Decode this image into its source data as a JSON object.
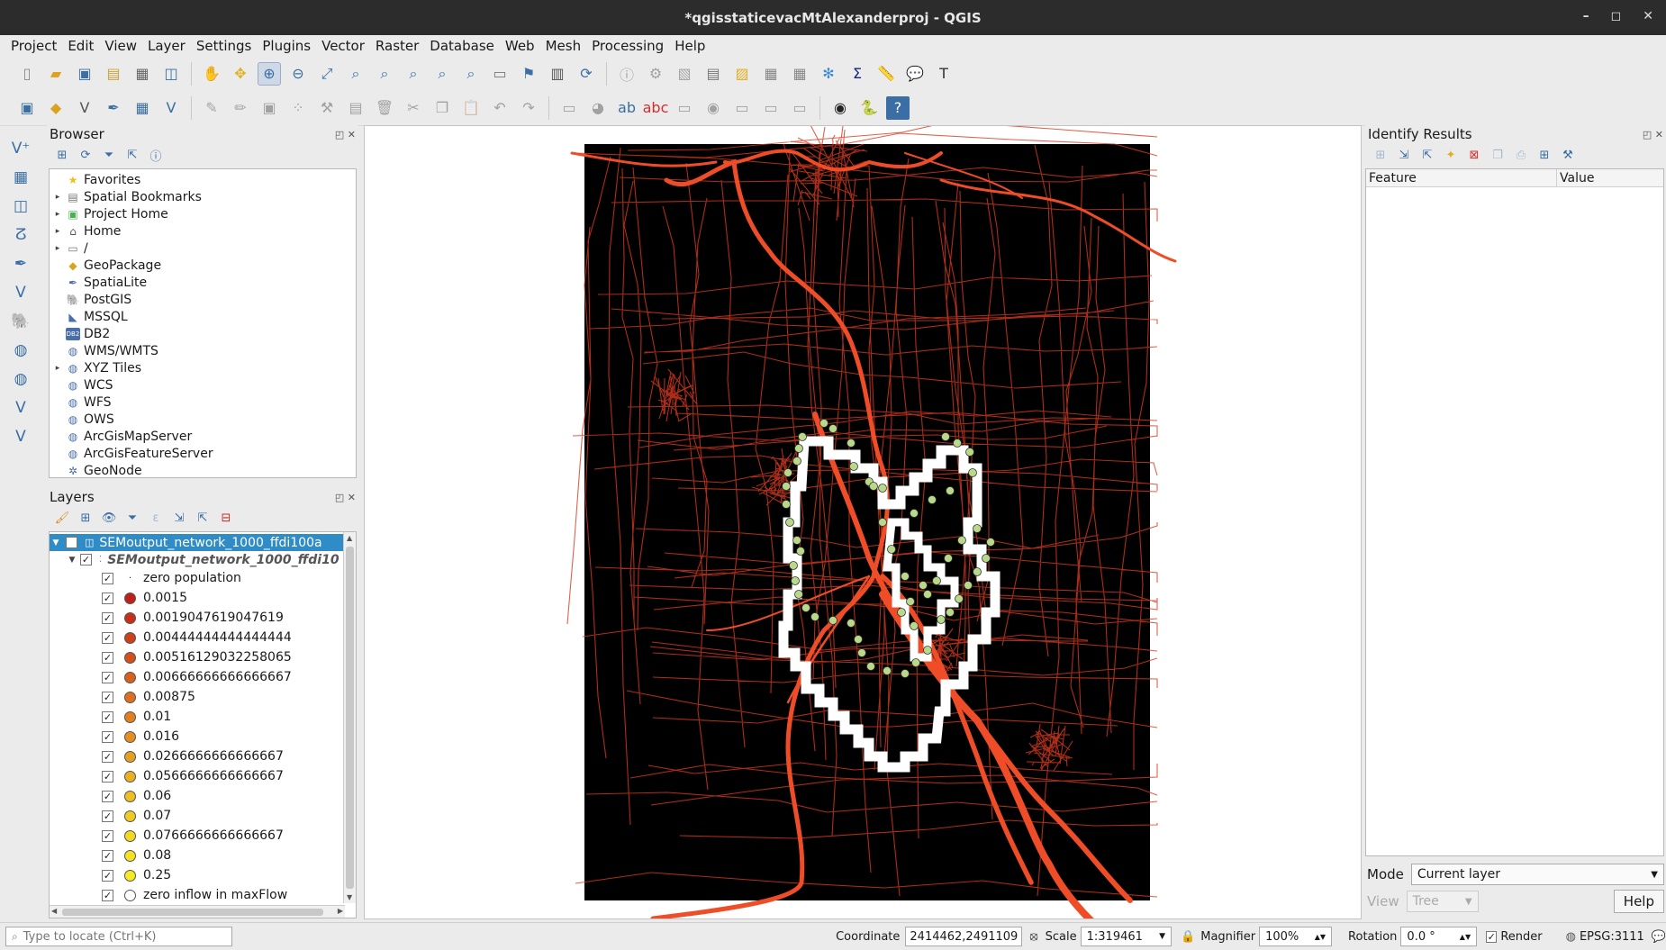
{
  "window": {
    "title": "*qgisstaticevacMtAlexanderproj - QGIS",
    "minimize": "–",
    "restore": "◻",
    "close": "✕"
  },
  "menu": [
    "Project",
    "Edit",
    "View",
    "Layer",
    "Settings",
    "Plugins",
    "Vector",
    "Raster",
    "Database",
    "Web",
    "Mesh",
    "Processing",
    "Help"
  ],
  "browser": {
    "title": "Browser",
    "items": [
      {
        "label": "Favorites",
        "icon": "star-icon",
        "glyph": "★",
        "color": "#e8c21b",
        "arrow": ""
      },
      {
        "label": "Spatial Bookmarks",
        "icon": "bookmark-icon",
        "glyph": "▤",
        "color": "#777",
        "arrow": "▸"
      },
      {
        "label": "Project Home",
        "icon": "project-home-icon",
        "glyph": "▣",
        "color": "#4caf50",
        "arrow": "▸"
      },
      {
        "label": "Home",
        "icon": "home-icon",
        "glyph": "⌂",
        "color": "#555",
        "arrow": "▸"
      },
      {
        "label": "/",
        "icon": "folder-icon",
        "glyph": "▭",
        "color": "#777",
        "arrow": "▸"
      },
      {
        "label": "GeoPackage",
        "icon": "geopackage-icon",
        "glyph": "◆",
        "color": "#d8a420",
        "arrow": ""
      },
      {
        "label": "SpatiaLite",
        "icon": "spatialite-icon",
        "glyph": "✒",
        "color": "#4a6ea8",
        "arrow": ""
      },
      {
        "label": "PostGIS",
        "icon": "postgis-icon",
        "glyph": "🐘",
        "color": "#336791",
        "arrow": ""
      },
      {
        "label": "MSSQL",
        "icon": "mssql-icon",
        "glyph": "◣",
        "color": "#4a6ea8",
        "arrow": ""
      },
      {
        "label": "DB2",
        "icon": "db2-icon",
        "glyph": "DB2",
        "color": "#4a6ea8",
        "arrow": ""
      },
      {
        "label": "WMS/WMTS",
        "icon": "wms-icon",
        "glyph": "◍",
        "color": "#4a6ea8",
        "arrow": ""
      },
      {
        "label": "XYZ Tiles",
        "icon": "xyz-tiles-icon",
        "glyph": "◍",
        "color": "#4a6ea8",
        "arrow": "▸"
      },
      {
        "label": "WCS",
        "icon": "wcs-icon",
        "glyph": "◍",
        "color": "#4a6ea8",
        "arrow": ""
      },
      {
        "label": "WFS",
        "icon": "wfs-icon",
        "glyph": "◍",
        "color": "#4a6ea8",
        "arrow": ""
      },
      {
        "label": "OWS",
        "icon": "ows-icon",
        "glyph": "◍",
        "color": "#4a6ea8",
        "arrow": ""
      },
      {
        "label": "ArcGisMapServer",
        "icon": "arcgis-map-icon",
        "glyph": "◍",
        "color": "#4a6ea8",
        "arrow": ""
      },
      {
        "label": "ArcGisFeatureServer",
        "icon": "arcgis-feature-icon",
        "glyph": "◍",
        "color": "#4a6ea8",
        "arrow": ""
      },
      {
        "label": "GeoNode",
        "icon": "geonode-icon",
        "glyph": "✲",
        "color": "#4a6ea8",
        "arrow": ""
      }
    ]
  },
  "layers": {
    "title": "Layers",
    "layer_name": "SEMoutput_network_1000_ffdi100a",
    "sublayer_name": "SEMoutput_network_1000_ffdi10",
    "classes": [
      {
        "label": "zero population",
        "color": "none",
        "style": "dot"
      },
      {
        "label": "0.0015",
        "color": "#c0201a"
      },
      {
        "label": "0.0019047619047619",
        "color": "#c6301a"
      },
      {
        "label": "0.00444444444444444",
        "color": "#cc401b"
      },
      {
        "label": "0.00516129032258065",
        "color": "#d2501c"
      },
      {
        "label": "0.00666666666666667",
        "color": "#d8601d"
      },
      {
        "label": "0.00875",
        "color": "#dd701e"
      },
      {
        "label": "0.01",
        "color": "#e0801f"
      },
      {
        "label": "0.016",
        "color": "#e39020"
      },
      {
        "label": "0.0266666666666667",
        "color": "#e6a021"
      },
      {
        "label": "0.0566666666666667",
        "color": "#e9b022"
      },
      {
        "label": "0.06",
        "color": "#ecbf22"
      },
      {
        "label": "0.07",
        "color": "#efcc22"
      },
      {
        "label": "0.0766666666666667",
        "color": "#f2d822"
      },
      {
        "label": "0.08",
        "color": "#f4e122"
      },
      {
        "label": "0.25",
        "color": "#f6ea22"
      },
      {
        "label": "zero inflow in maxFlow",
        "color": "#ffffff"
      }
    ]
  },
  "identify": {
    "title": "Identify Results",
    "col_feature": "Feature",
    "col_value": "Value",
    "mode_label": "Mode",
    "mode_value": "Current layer",
    "view_label": "View",
    "view_value": "Tree",
    "help": "Help"
  },
  "status": {
    "locator_placeholder": "Type to locate (Ctrl+K)",
    "coordinate_label": "Coordinate",
    "coordinate_value": "2414462,2491109",
    "scale_label": "Scale",
    "scale_value": "1:319461",
    "magnifier_label": "Magnifier",
    "magnifier_value": "100%",
    "rotation_label": "Rotation",
    "rotation_value": "0.0 °",
    "render_label": "Render",
    "crs": "EPSG:3111"
  },
  "colors": {
    "road": "#e8431f",
    "road_major": "#ee4d28",
    "canvas_black": "#000000",
    "boundary": "#ffffff",
    "node": "#b8d98a",
    "selection": "#308cc6"
  }
}
